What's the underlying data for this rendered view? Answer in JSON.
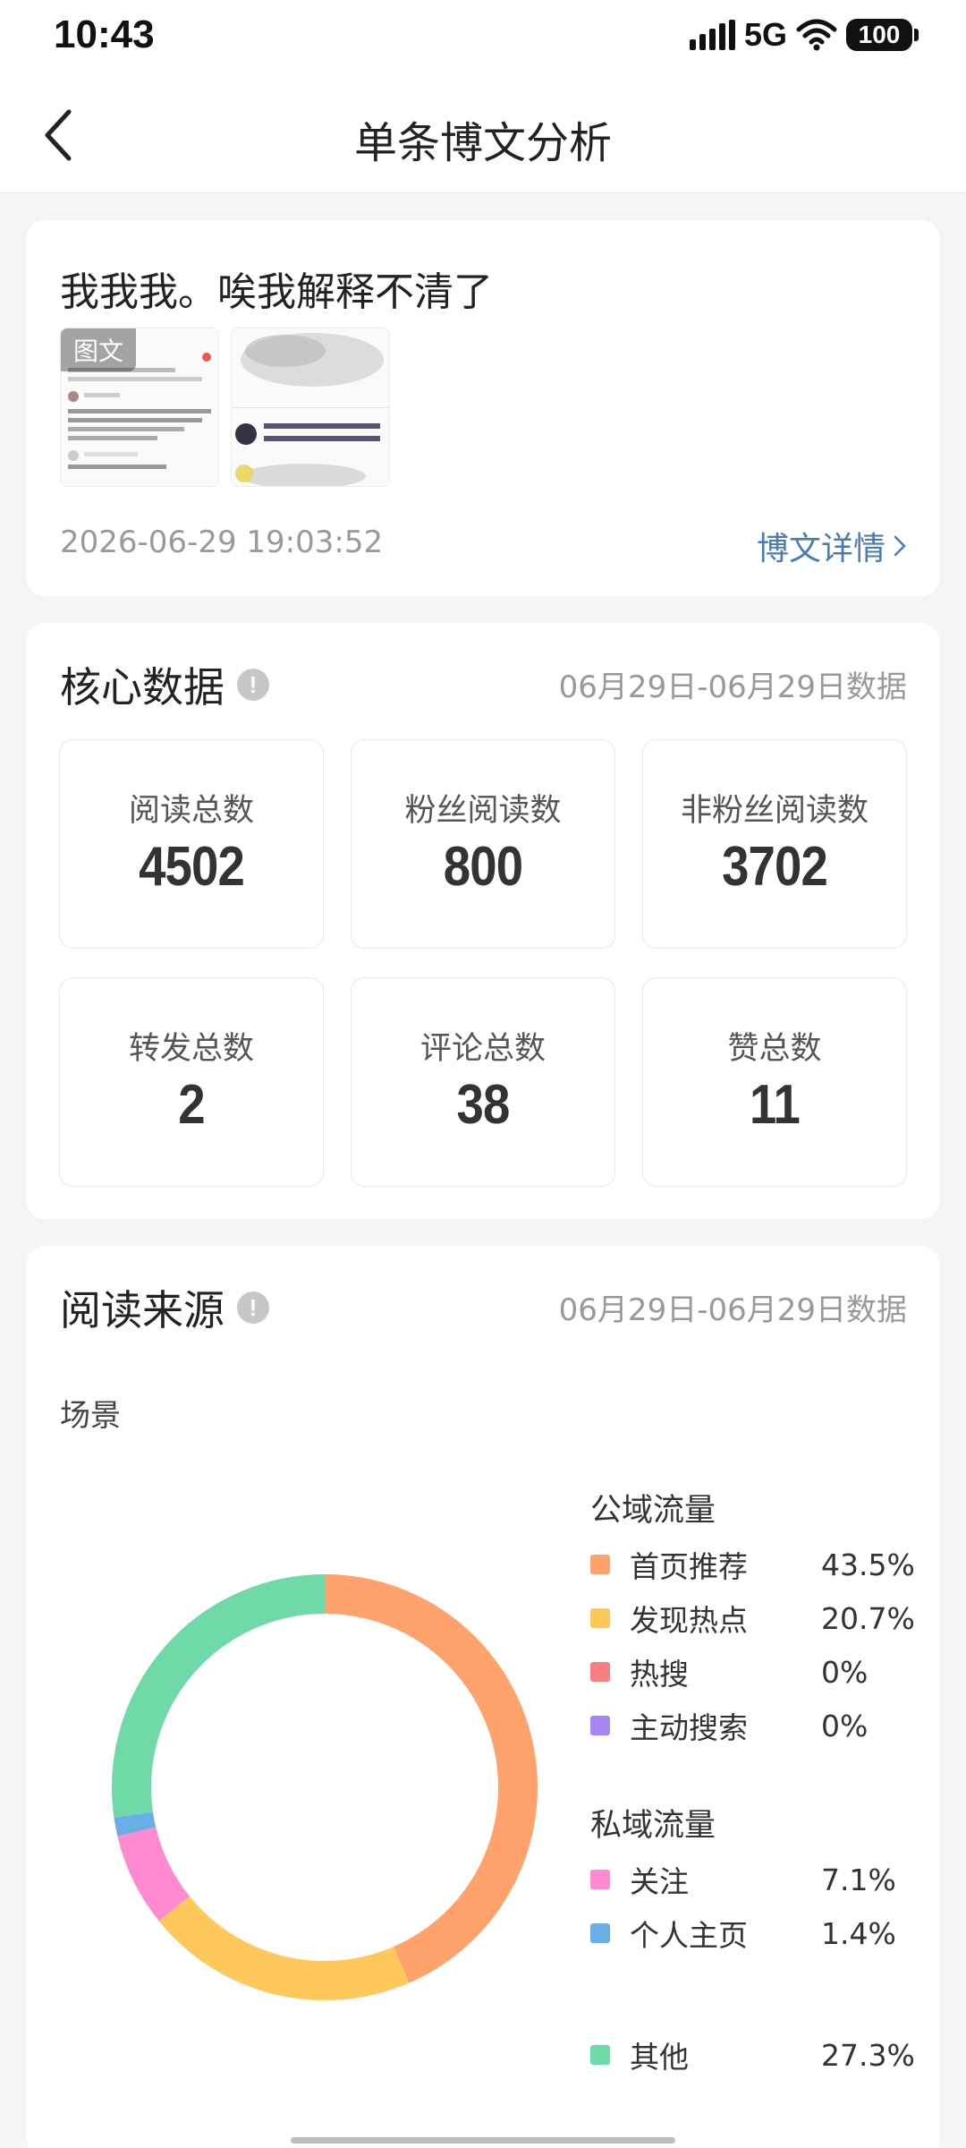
{
  "status_bar": {
    "time": "10:43",
    "network": "5G",
    "battery": "100"
  },
  "nav": {
    "title": "单条博文分析"
  },
  "post": {
    "text": "我我我。唉我解释不清了",
    "thumbnail_tag": "图文",
    "timestamp": "2026-06-29 19:03:52",
    "detail_link": "博文详情"
  },
  "core": {
    "title": "核心数据",
    "date_range": "06月29日-06月29日数据",
    "stats": [
      {
        "label": "阅读总数",
        "value": "4502"
      },
      {
        "label": "粉丝阅读数",
        "value": "800"
      },
      {
        "label": "非粉丝阅读数",
        "value": "3702"
      },
      {
        "label": "转发总数",
        "value": "2"
      },
      {
        "label": "评论总数",
        "value": "38"
      },
      {
        "label": "赞总数",
        "value": "11"
      }
    ]
  },
  "source": {
    "title": "阅读来源",
    "date_range": "06月29日-06月29日数据",
    "scene_label": "场景",
    "public_title": "公域流量",
    "private_title": "私域流量"
  },
  "chart_data": {
    "type": "pie",
    "style": "donut",
    "start": "top, clockwise",
    "categories": [
      "首页推荐",
      "发现热点",
      "热搜",
      "主动搜索",
      "关注",
      "个人主页",
      "其他"
    ],
    "values": [
      43.5,
      20.7,
      0,
      0,
      7.1,
      1.4,
      27.3
    ],
    "labels": [
      "43.5%",
      "20.7%",
      "0%",
      "0%",
      "7.1%",
      "1.4%",
      "27.3%"
    ],
    "colors": [
      "#ffa26b",
      "#ffc85a",
      "#f87f7f",
      "#a884f3",
      "#ff8ad0",
      "#6aaee6",
      "#6fd9a8"
    ],
    "groups": {
      "公域流量": [
        0,
        1,
        2,
        3
      ],
      "私域流量": [
        4,
        5
      ],
      "": [
        6
      ]
    }
  }
}
